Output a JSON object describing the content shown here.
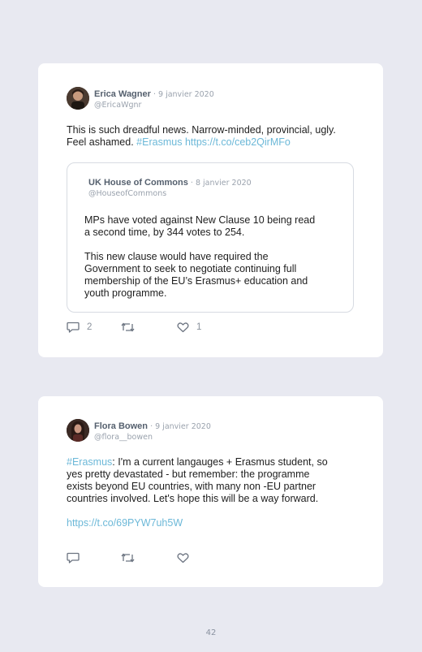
{
  "tweets": [
    {
      "author": "Erica Wagner",
      "date": "· 9 janvier 2020",
      "handle": "@EricaWgnr",
      "text_lines": [
        "This is such dreadful news. Narrow-minded, provincial, ugly.",
        "Feel ashamed. "
      ],
      "hashtag": "#Erasmus",
      "url": "https://t.co/ceb2QirMFo",
      "quoted": {
        "author": "UK House of Commons",
        "date": "· 8 janvier 2020",
        "handle": "@HouseofCommons",
        "paragraph1_lines": [
          "MPs have voted against New Clause 10 being read",
          "a second time, by 344 votes to 254."
        ],
        "paragraph2_lines": [
          "This new clause would have required the",
          "Government to seek to negotiate continuing full",
          "membership of the EU’s Erasmus+ education and",
          "youth programme."
        ]
      },
      "actions": {
        "reply_icon": "reply-icon",
        "reply_count": "2",
        "retweet_icon": "retweet-icon",
        "like_icon": "heart-icon",
        "like_count": "1"
      }
    },
    {
      "author": "Flora Bowen",
      "date": "· 9 janvier 2020",
      "handle": "@flora__bowen",
      "hashtag": "#Erasmus",
      "text_lines": [
        ": I'm a current langauges + Erasmus student, so",
        "yes pretty devastated - but remember: the programme",
        "exists beyond EU countries, with many non -EU partner",
        "countries involved. Let's hope this will be a way forward."
      ],
      "url": "https://t.co/69PYW7uh5W",
      "actions": {
        "reply_icon": "reply-icon",
        "retweet_icon": "retweet-icon",
        "like_icon": "heart-icon"
      }
    }
  ],
  "page_number": "42",
  "colors": {
    "background": "#e8e9f1",
    "card": "#ffffff",
    "link": "#6cb8d8",
    "author": "#55606e",
    "meta": "#9aa2ad"
  }
}
